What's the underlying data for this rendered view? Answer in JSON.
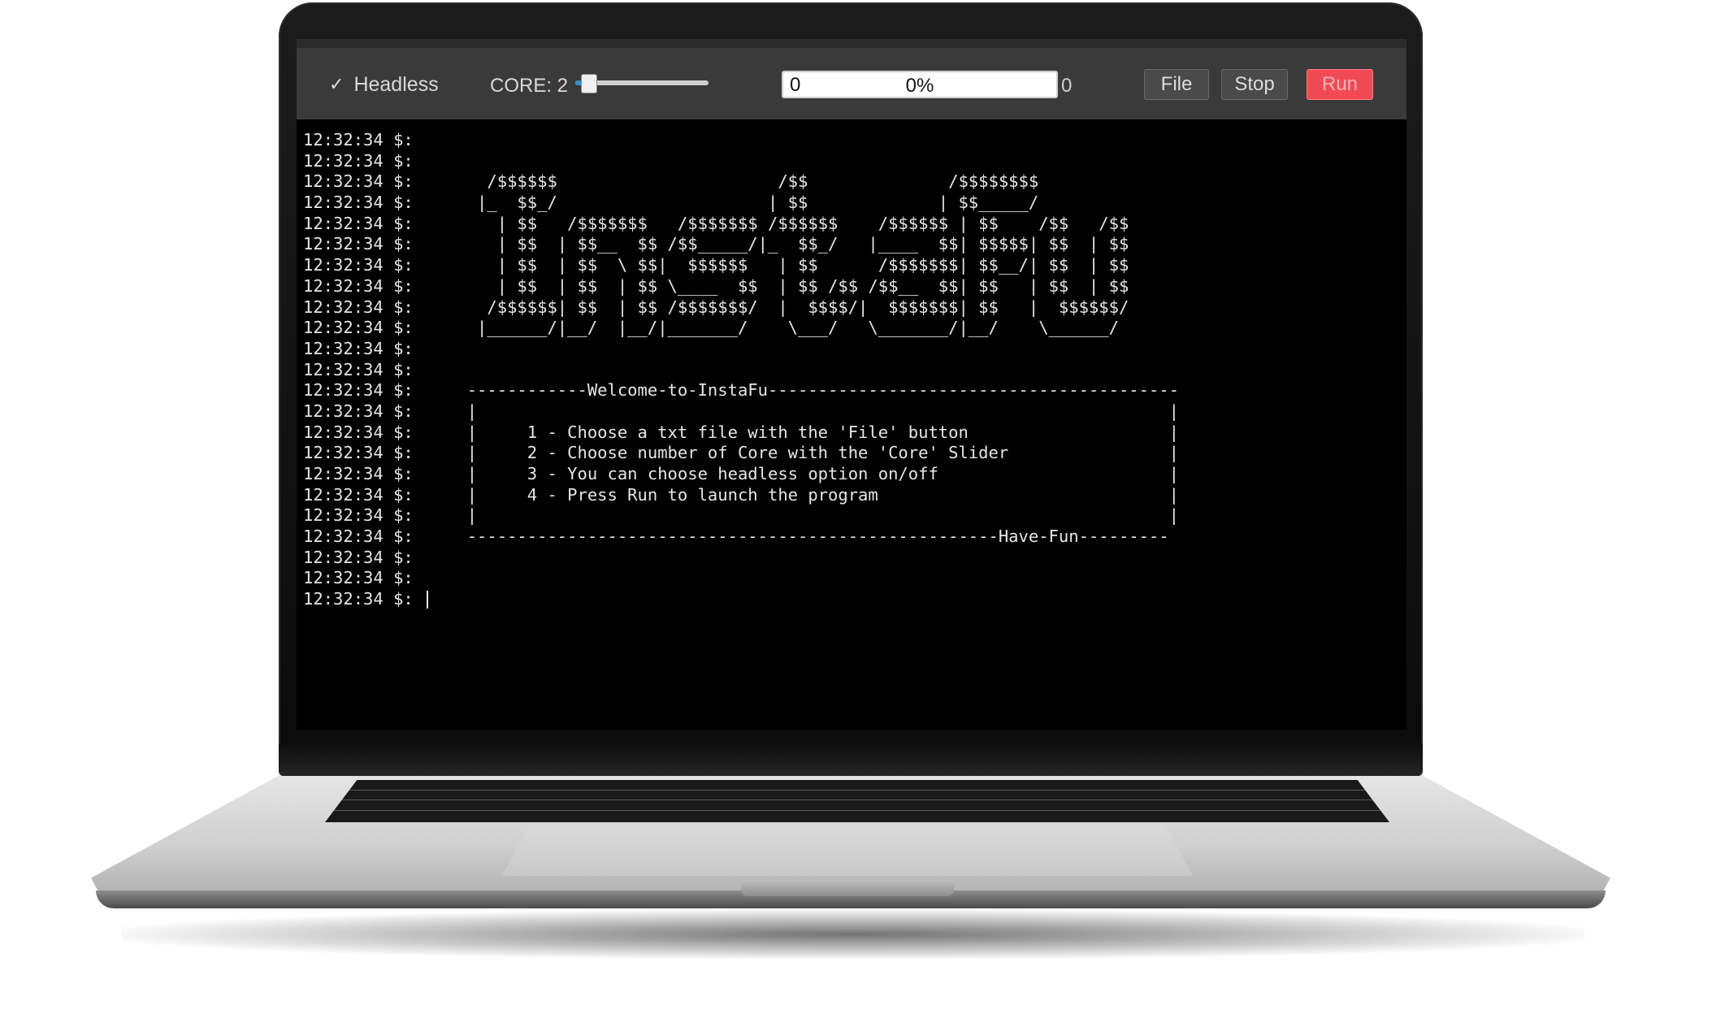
{
  "toolbar": {
    "headless_label": "Headless",
    "headless_checked": true,
    "core_label": "CORE: 2",
    "core_value": 2,
    "core_slider_fraction": 0.1,
    "progress_left": "0",
    "progress_percent": "0%",
    "progress_fraction": 0,
    "progress_right": "0",
    "file_label": "File",
    "stop_label": "Stop",
    "run_label": "Run",
    "accent_color": "#2c8fd6",
    "run_color": "#f24a55"
  },
  "terminal": {
    "prompt": "12:32:34 $:",
    "lines": [
      "",
      "",
      "       /$$$$$$                      /$$              /$$$$$$$$",
      "      |_  $$_/                     | $$             | $$_____/",
      "        | $$   /$$$$$$$   /$$$$$$$ /$$$$$$    /$$$$$$ | $$    /$$   /$$",
      "        | $$  | $$__  $$ /$$_____/|_  $$_/   |____  $$| $$$$$| $$  | $$",
      "        | $$  | $$  \\ $$|  $$$$$$   | $$      /$$$$$$$| $$__/| $$  | $$",
      "        | $$  | $$  | $$ \\____  $$  | $$ /$$ /$$__  $$| $$   | $$  | $$",
      "       /$$$$$$| $$  | $$ /$$$$$$$/  |  $$$$/|  $$$$$$$| $$   |  $$$$$$/",
      "      |______/|__/  |__/|_______/    \\___/   \\_______/|__/    \\______/",
      "",
      "",
      "     ------------Welcome-to-InstaFu-----------------------------------------",
      "     |                                                                     |",
      "     |     1 - Choose a txt file with the 'File' button                    |",
      "     |     2 - Choose number of Core with the 'Core' Slider                |",
      "     |     3 - You can choose headless option on/off                       |",
      "     |     4 - Press Run to launch the program                             |",
      "     |                                                                     |",
      "     -----------------------------------------------------Have-Fun---------",
      "",
      "",
      ""
    ]
  }
}
